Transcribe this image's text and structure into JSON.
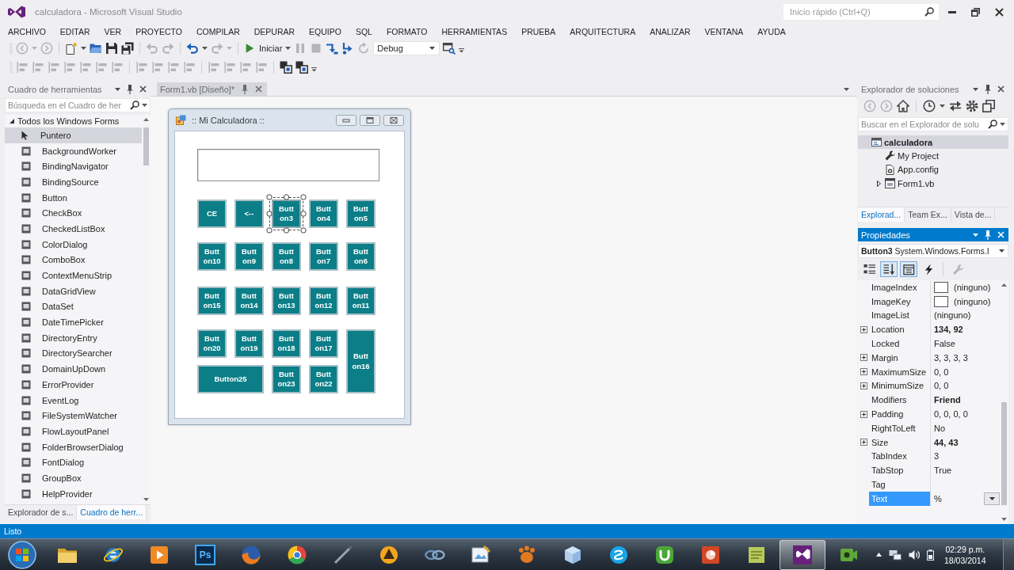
{
  "window": {
    "title": "calculadora - Microsoft Visual Studio"
  },
  "quick_launch": {
    "placeholder": "Inicio rápido (Ctrl+Q)"
  },
  "menu": [
    "ARCHIVO",
    "EDITAR",
    "VER",
    "PROYECTO",
    "COMPILAR",
    "DEPURAR",
    "EQUIPO",
    "SQL",
    "FORMATO",
    "HERRAMIENTAS",
    "PRUEBA",
    "ARQUITECTURA",
    "ANALIZAR",
    "VENTANA",
    "AYUDA"
  ],
  "toolbar_standard": [
    {
      "kind": "back",
      "disabled": true,
      "menu": true
    },
    {
      "kind": "forward",
      "disabled": true
    },
    {
      "kind": "separator"
    },
    {
      "kind": "new-project",
      "disabled": false,
      "menu": true
    },
    {
      "kind": "open",
      "disabled": false
    },
    {
      "kind": "save",
      "disabled": false
    },
    {
      "kind": "save-all",
      "disabled": false
    },
    {
      "kind": "separator"
    },
    {
      "kind": "undo",
      "disabled": true
    },
    {
      "kind": "redo",
      "disabled": true
    },
    {
      "kind": "separator"
    },
    {
      "kind": "undo",
      "disabled": false,
      "menu": true
    },
    {
      "kind": "redo",
      "disabled": true,
      "menu": true
    },
    {
      "kind": "separator"
    },
    {
      "kind": "run",
      "label": "Iniciar",
      "disabled": false,
      "menu": true
    },
    {
      "kind": "pause",
      "disabled": true
    },
    {
      "kind": "stop",
      "disabled": true
    },
    {
      "kind": "step-back",
      "disabled": false
    },
    {
      "kind": "step-into",
      "disabled": false
    },
    {
      "kind": "restart",
      "disabled": true
    },
    {
      "kind": "combo",
      "value": "Debug"
    },
    {
      "kind": "find",
      "disabled": false
    },
    {
      "kind": "overflow"
    }
  ],
  "toolbar_layout": [
    {
      "kind": "align",
      "disabled": true
    },
    {
      "kind": "align",
      "disabled": true
    },
    {
      "kind": "align",
      "disabled": true
    },
    {
      "kind": "align",
      "disabled": true
    },
    {
      "kind": "align",
      "disabled": true
    },
    {
      "kind": "align",
      "disabled": true
    },
    {
      "kind": "align",
      "disabled": true
    },
    {
      "kind": "separator"
    },
    {
      "kind": "align",
      "disabled": true
    },
    {
      "kind": "align",
      "disabled": true
    },
    {
      "kind": "align",
      "disabled": true
    },
    {
      "kind": "align",
      "disabled": true
    },
    {
      "kind": "separator"
    },
    {
      "kind": "align",
      "disabled": true
    },
    {
      "kind": "align",
      "disabled": true
    },
    {
      "kind": "align",
      "disabled": true
    },
    {
      "kind": "align",
      "disabled": true
    },
    {
      "kind": "separator"
    },
    {
      "kind": "layer",
      "disabled": false
    },
    {
      "kind": "layer",
      "disabled": false
    },
    {
      "kind": "overflow"
    }
  ],
  "toolbox": {
    "title": "Cuadro de herramientas",
    "search": {
      "placeholder": "Búsqueda en el Cuadro de her"
    },
    "group": {
      "label": "Todos los Windows Forms",
      "expanded": true
    },
    "items": [
      {
        "label": "Puntero",
        "kind": "pointer",
        "selected": true
      },
      {
        "label": "BackgroundWorker",
        "kind": "control",
        "selected": false
      },
      {
        "label": "BindingNavigator",
        "kind": "control",
        "selected": false
      },
      {
        "label": "BindingSource",
        "kind": "control",
        "selected": false
      },
      {
        "label": "Button",
        "kind": "control",
        "selected": false
      },
      {
        "label": "CheckBox",
        "kind": "control",
        "selected": false
      },
      {
        "label": "CheckedListBox",
        "kind": "control",
        "selected": false
      },
      {
        "label": "ColorDialog",
        "kind": "control",
        "selected": false
      },
      {
        "label": "ComboBox",
        "kind": "control",
        "selected": false
      },
      {
        "label": "ContextMenuStrip",
        "kind": "control",
        "selected": false
      },
      {
        "label": "DataGridView",
        "kind": "control",
        "selected": false
      },
      {
        "label": "DataSet",
        "kind": "control",
        "selected": false
      },
      {
        "label": "DateTimePicker",
        "kind": "control",
        "selected": false
      },
      {
        "label": "DirectoryEntry",
        "kind": "control",
        "selected": false
      },
      {
        "label": "DirectorySearcher",
        "kind": "control",
        "selected": false
      },
      {
        "label": "DomainUpDown",
        "kind": "control",
        "selected": false
      },
      {
        "label": "ErrorProvider",
        "kind": "control",
        "selected": false
      },
      {
        "label": "EventLog",
        "kind": "control",
        "selected": false
      },
      {
        "label": "FileSystemWatcher",
        "kind": "control",
        "selected": false
      },
      {
        "label": "FlowLayoutPanel",
        "kind": "control",
        "selected": false
      },
      {
        "label": "FolderBrowserDialog",
        "kind": "control",
        "selected": false
      },
      {
        "label": "FontDialog",
        "kind": "control",
        "selected": false
      },
      {
        "label": "GroupBox",
        "kind": "control",
        "selected": false
      },
      {
        "label": "HelpProvider",
        "kind": "control",
        "selected": false
      }
    ],
    "tabs": [
      {
        "label": "Explorador de s...",
        "selected": false
      },
      {
        "label": "Cuadro de herr...",
        "selected": true
      }
    ]
  },
  "document_tabs": [
    {
      "label": "Form1.vb [Diseño]*",
      "selected": true
    }
  ],
  "form": {
    "title": ":: Mi Calculadora ::",
    "buttons": [
      {
        "label": "CE",
        "kind": "normal",
        "selected": false
      },
      {
        "label": "<--",
        "kind": "normal",
        "selected": false
      },
      {
        "label": "Button3",
        "kind": "normal",
        "selected": true
      },
      {
        "label": "Button4",
        "kind": "normal",
        "selected": false
      },
      {
        "label": "Button5",
        "kind": "normal",
        "selected": false
      },
      {
        "label": "Button10",
        "kind": "normal",
        "selected": false
      },
      {
        "label": "Button9",
        "kind": "normal",
        "selected": false
      },
      {
        "label": "Button8",
        "kind": "normal",
        "selected": false
      },
      {
        "label": "Button7",
        "kind": "normal",
        "selected": false
      },
      {
        "label": "Button6",
        "kind": "normal",
        "selected": false
      },
      {
        "label": "Button15",
        "kind": "normal",
        "selected": false
      },
      {
        "label": "Button14",
        "kind": "normal",
        "selected": false
      },
      {
        "label": "Button13",
        "kind": "normal",
        "selected": false
      },
      {
        "label": "Button12",
        "kind": "normal",
        "selected": false
      },
      {
        "label": "Button11",
        "kind": "normal",
        "selected": false
      },
      {
        "label": "Button20",
        "kind": "normal",
        "selected": false
      },
      {
        "label": "Button19",
        "kind": "normal",
        "selected": false
      },
      {
        "label": "Button18",
        "kind": "normal",
        "selected": false
      },
      {
        "label": "Button17",
        "kind": "normal",
        "selected": false
      },
      {
        "label": "Button16",
        "kind": "tall",
        "selected": false
      },
      {
        "label": "Button25",
        "kind": "wide",
        "selected": false
      },
      {
        "label": "Button23",
        "kind": "normal",
        "selected": false
      },
      {
        "label": "Button22",
        "kind": "normal",
        "selected": false
      }
    ]
  },
  "solution_explorer": {
    "title": "Explorador de soluciones",
    "toolbar": [
      {
        "kind": "back",
        "disabled": true
      },
      {
        "kind": "forward",
        "disabled": true
      },
      {
        "kind": "home",
        "disabled": false
      },
      {
        "kind": "separator"
      },
      {
        "kind": "history",
        "disabled": false,
        "menu": true
      },
      {
        "kind": "sync",
        "disabled": false
      },
      {
        "kind": "settings",
        "disabled": false
      },
      {
        "kind": "collapse",
        "disabled": false
      }
    ],
    "search": {
      "placeholder": "Buscar en el Explorador de solu"
    },
    "tree": [
      {
        "label": "calculadora",
        "kind": "project",
        "selected": true,
        "children": [
          {
            "label": "My Project",
            "kind": "settings",
            "selected": false
          },
          {
            "label": "App.config",
            "kind": "config",
            "selected": false
          },
          {
            "label": "Form1.vb",
            "kind": "form",
            "selected": false,
            "expanded": false
          }
        ]
      }
    ],
    "tabs": [
      {
        "label": "Explorad...",
        "selected": true
      },
      {
        "label": "Team Ex...",
        "selected": false
      },
      {
        "label": "Vista de...",
        "selected": false
      }
    ]
  },
  "properties": {
    "title": "Propiedades",
    "object": "**Button3** System.Windows.Forms.I",
    "toolbar": [
      {
        "kind": "categorized",
        "selected": false,
        "disabled": false
      },
      {
        "kind": "alphabetical",
        "selected": true,
        "disabled": false
      },
      {
        "kind": "property-page",
        "selected": true,
        "disabled": false
      },
      {
        "kind": "events",
        "selected": false,
        "disabled": false
      },
      {
        "kind": "property-pages",
        "selected": false,
        "disabled": true
      }
    ],
    "rows": [
      {
        "name": "ImageIndex",
        "value": "(ninguno)",
        "kind": "swatch",
        "selected": false
      },
      {
        "name": "ImageKey",
        "value": "(ninguno)",
        "kind": "swatch",
        "selected": false
      },
      {
        "name": "ImageList",
        "value": "(ninguno)",
        "kind": "plain",
        "selected": false
      },
      {
        "name": "Location",
        "value": "134, 92",
        "kind": "group",
        "modified": true,
        "selected": false
      },
      {
        "name": "Locked",
        "value": "False",
        "kind": "plain",
        "selected": false
      },
      {
        "name": "Margin",
        "value": "3, 3, 3, 3",
        "kind": "group",
        "selected": false
      },
      {
        "name": "MaximumSize",
        "value": "0, 0",
        "kind": "group",
        "selected": false
      },
      {
        "name": "MinimumSize",
        "value": "0, 0",
        "kind": "group",
        "selected": false
      },
      {
        "name": "Modifiers",
        "value": "Friend",
        "kind": "plain",
        "modified": true,
        "selected": false
      },
      {
        "name": "Padding",
        "value": "0, 0, 0, 0",
        "kind": "group",
        "selected": false
      },
      {
        "name": "RightToLeft",
        "value": "No",
        "kind": "plain",
        "selected": false
      },
      {
        "name": "Size",
        "value": "44, 43",
        "kind": "group",
        "modified": true,
        "selected": false
      },
      {
        "name": "TabIndex",
        "value": "3",
        "kind": "plain",
        "selected": false
      },
      {
        "name": "TabStop",
        "value": "True",
        "kind": "plain",
        "selected": false
      },
      {
        "name": "Tag",
        "kind": "plain",
        "selected": false
      },
      {
        "name": "Text",
        "value": "%",
        "kind": "plain",
        "selected": true
      }
    ]
  },
  "status_bar": {
    "text": "Listo"
  },
  "taskbar": {
    "apps": [
      {
        "kind": "explorer",
        "selected": false
      },
      {
        "kind": "browser-e",
        "selected": false
      },
      {
        "kind": "media",
        "selected": false
      },
      {
        "kind": "photo-editor",
        "glyph": "Ps",
        "selected": false
      },
      {
        "kind": "flame-globe",
        "selected": false
      },
      {
        "kind": "ball",
        "selected": false
      },
      {
        "kind": "pen",
        "selected": false
      },
      {
        "kind": "cone",
        "selected": false
      },
      {
        "kind": "chain",
        "selected": false
      },
      {
        "kind": "paint",
        "selected": false
      },
      {
        "kind": "paw",
        "selected": false
      },
      {
        "kind": "cube",
        "selected": false
      },
      {
        "kind": "chat",
        "selected": false
      },
      {
        "kind": "magnet",
        "selected": false
      },
      {
        "kind": "slides",
        "selected": false
      },
      {
        "kind": "notes",
        "selected": false
      },
      {
        "kind": "ide",
        "selected": true
      },
      {
        "kind": "recorder",
        "selected": false
      }
    ],
    "time": "02:29 p.m.",
    "date": "18/03/2014"
  }
}
